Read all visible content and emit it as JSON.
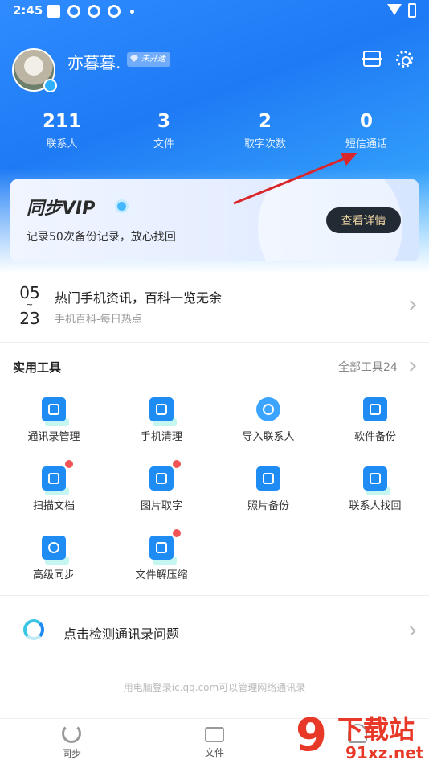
{
  "status_bar": {
    "time": "2:45"
  },
  "profile": {
    "username": "亦暮暮.",
    "vip_status": "未开通"
  },
  "stats": [
    {
      "value": "211",
      "label": "联系人"
    },
    {
      "value": "3",
      "label": "文件"
    },
    {
      "value": "2",
      "label": "取字次数"
    },
    {
      "value": "0",
      "label": "短信通话"
    }
  ],
  "vip_card": {
    "title": "同步VIP",
    "description": "记录50次备份记录，放心找回",
    "button": "查看详情"
  },
  "news": {
    "month": "05",
    "separator": "~",
    "day": "23",
    "title": "热门手机资讯，百科一览无余",
    "subtitle": "手机百科-每日热点"
  },
  "tools": {
    "heading": "实用工具",
    "all_label": "全部工具24",
    "items": [
      {
        "label": "通讯录管理",
        "icon": "contact-book-icon",
        "badge": false
      },
      {
        "label": "手机清理",
        "icon": "phone-clean-icon",
        "badge": false
      },
      {
        "label": "导入联系人",
        "icon": "import-contact-icon",
        "badge": false
      },
      {
        "label": "软件备份",
        "icon": "app-backup-icon",
        "badge": false
      },
      {
        "label": "扫描文档",
        "icon": "scan-doc-icon",
        "badge": true
      },
      {
        "label": "图片取字",
        "icon": "image-text-icon",
        "badge": true
      },
      {
        "label": "照片备份",
        "icon": "photo-backup-icon",
        "badge": false
      },
      {
        "label": "联系人找回",
        "icon": "contact-recover-icon",
        "badge": false
      },
      {
        "label": "高级同步",
        "icon": "advanced-sync-icon",
        "badge": false
      },
      {
        "label": "文件解压缩",
        "icon": "unzip-icon",
        "badge": true
      }
    ]
  },
  "check": {
    "label": "点击检测通讯录问题"
  },
  "hint": "用电脑登录ic.qq.com可以管理网络通讯录",
  "bottom_nav": [
    {
      "label": "同步",
      "icon": "sync-icon"
    },
    {
      "label": "文件",
      "icon": "folder-icon"
    },
    {
      "label": "",
      "icon": "person-icon"
    }
  ],
  "watermark": {
    "line1": "下载站",
    "line2": "91xz.net"
  },
  "colors": {
    "primary": "#1e8cf2",
    "badge_red": "#f25555",
    "vip_button_bg": "#222a33",
    "annotation_arrow": "#d9262a"
  }
}
